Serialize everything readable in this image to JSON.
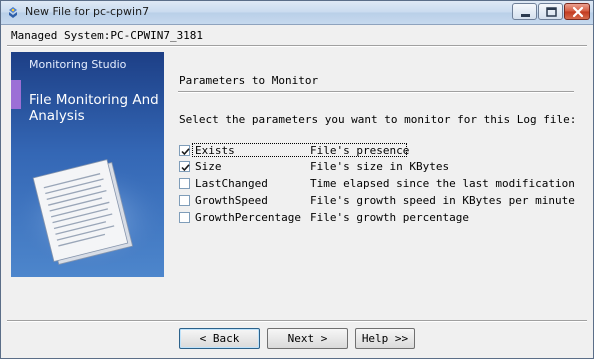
{
  "window": {
    "title": "New File for pc-cpwin7",
    "icons": {
      "app": "app-icon",
      "minimize": "minimize-icon",
      "maximize": "maximize-icon",
      "close": "close-icon"
    }
  },
  "header": {
    "managed_system": "Managed System:PC-CPWIN7_3181"
  },
  "banner": {
    "brand": "Monitoring Studio",
    "title": "File Monitoring And Analysis",
    "colors": {
      "top": "#1d3f86",
      "bottom": "#4d86cc",
      "stripe": "#9c6fd6"
    }
  },
  "main": {
    "section_title": "Parameters to Monitor",
    "instruction": "Select the parameters you want to monitor for this Log file:",
    "parameters": [
      {
        "name": "Exists",
        "description": "File's presence",
        "checked": true
      },
      {
        "name": "Size",
        "description": "File's size in KBytes",
        "checked": true
      },
      {
        "name": "LastChanged",
        "description": "Time elapsed since the last modification",
        "checked": false
      },
      {
        "name": "GrowthSpeed",
        "description": "File's growth speed in KBytes per minute",
        "checked": false
      },
      {
        "name": "GrowthPercentage",
        "description": "File's growth percentage",
        "checked": false
      }
    ]
  },
  "buttons": {
    "back": "< Back",
    "next": "Next >",
    "help": "Help >>"
  }
}
